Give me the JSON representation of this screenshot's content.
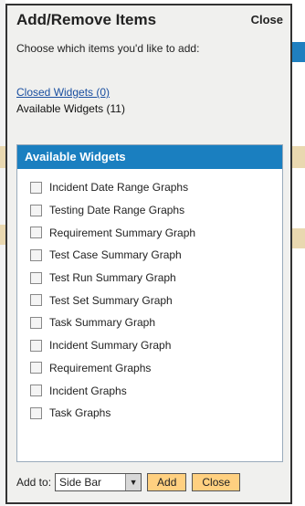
{
  "dialog": {
    "title": "Add/Remove Items",
    "close_label": "Close",
    "instructions": "Choose which items you'd like to add:",
    "closed_widgets_link": "Closed Widgets (0)",
    "available_widgets_text": "Available Widgets (11)"
  },
  "panel": {
    "header": "Available Widgets",
    "items": [
      {
        "label": "Incident Date Range Graphs",
        "checked": false
      },
      {
        "label": "Testing Date Range Graphs",
        "checked": false
      },
      {
        "label": "Requirement Summary Graph",
        "checked": false
      },
      {
        "label": "Test Case Summary Graph",
        "checked": false
      },
      {
        "label": "Test Run Summary Graph",
        "checked": false
      },
      {
        "label": "Test Set Summary Graph",
        "checked": false
      },
      {
        "label": "Task Summary Graph",
        "checked": false
      },
      {
        "label": "Incident Summary Graph",
        "checked": false
      },
      {
        "label": "Requirement Graphs",
        "checked": false
      },
      {
        "label": "Incident Graphs",
        "checked": false
      },
      {
        "label": "Task Graphs",
        "checked": false
      }
    ]
  },
  "footer": {
    "add_to_label": "Add to:",
    "select_value": "Side Bar",
    "add_button": "Add",
    "close_button": "Close"
  },
  "colors": {
    "header_blue": "#1a7fc0",
    "button_orange": "#ffd080"
  }
}
